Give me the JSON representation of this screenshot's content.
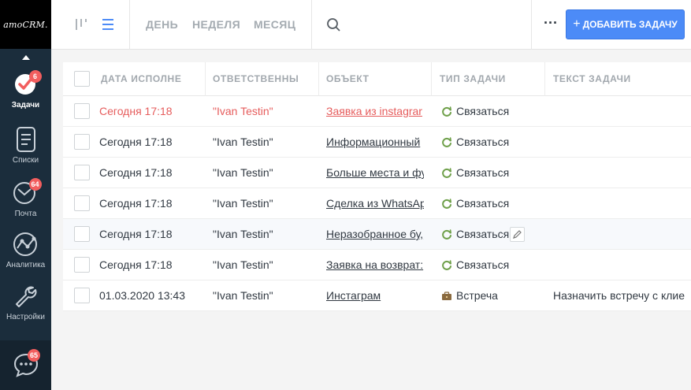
{
  "sidebar": {
    "logo": "amoCRM.",
    "items": [
      {
        "label": "Задачи",
        "badge": "6",
        "icon": "tasks-check-icon",
        "active": true
      },
      {
        "label": "Списки",
        "icon": "lists-icon"
      },
      {
        "label": "Почта",
        "badge": "64",
        "icon": "mail-icon"
      },
      {
        "label": "Аналитика",
        "icon": "analytics-icon"
      },
      {
        "label": "Настройки",
        "icon": "settings-wrench-icon"
      }
    ],
    "chat_badge": "65"
  },
  "topbar": {
    "periods": [
      "ДЕНЬ",
      "НЕДЕЛЯ",
      "МЕСЯЦ"
    ],
    "add_button": "ДОБАВИТЬ ЗАДАЧУ",
    "add_plus": "+",
    "more": "···"
  },
  "table": {
    "columns": [
      "ДАТА ИСПОЛНЕ",
      "ОТВЕТСТВЕННЫ",
      "ОБЪЕКТ",
      "ТИП ЗАДАЧИ",
      "ТЕКСТ ЗАДАЧИ"
    ],
    "rows": [
      {
        "date": "Сегодня 17:18",
        "user": "\"Ivan Testin\"",
        "object": "Заявка из instagrar",
        "type": "Связаться",
        "text": "",
        "overdue": true
      },
      {
        "date": "Сегодня 17:18",
        "user": "\"Ivan Testin\"",
        "object": "Информационный ",
        "type": "Связаться",
        "text": ""
      },
      {
        "date": "Сегодня 17:18",
        "user": "\"Ivan Testin\"",
        "object": "Больше места и фу",
        "type": "Связаться",
        "text": ""
      },
      {
        "date": "Сегодня 17:18",
        "user": "\"Ivan Testin\"",
        "object": "Сделка из WhatsAp",
        "type": "Связаться",
        "text": ""
      },
      {
        "date": "Сегодня 17:18",
        "user": "\"Ivan Testin\"",
        "object": "Неразобранное бу,",
        "type": "Связаться",
        "text": "",
        "hover": true
      },
      {
        "date": "Сегодня 17:18",
        "user": "\"Ivan Testin\"",
        "object": "Заявка на возврат:",
        "type": "Связаться",
        "text": ""
      },
      {
        "date": "01.03.2020 13:43",
        "user": "\"Ivan Testin\"",
        "object": "Инстаграм",
        "type": "Встреча",
        "text": "Назначить встречу с клие"
      }
    ]
  },
  "colors": {
    "sidebar": "#1b2d3c",
    "accent": "#4c8bf7",
    "overdue": "#e65c5c",
    "badge": "#f25e5e",
    "task_icon": "#6fa04a"
  }
}
